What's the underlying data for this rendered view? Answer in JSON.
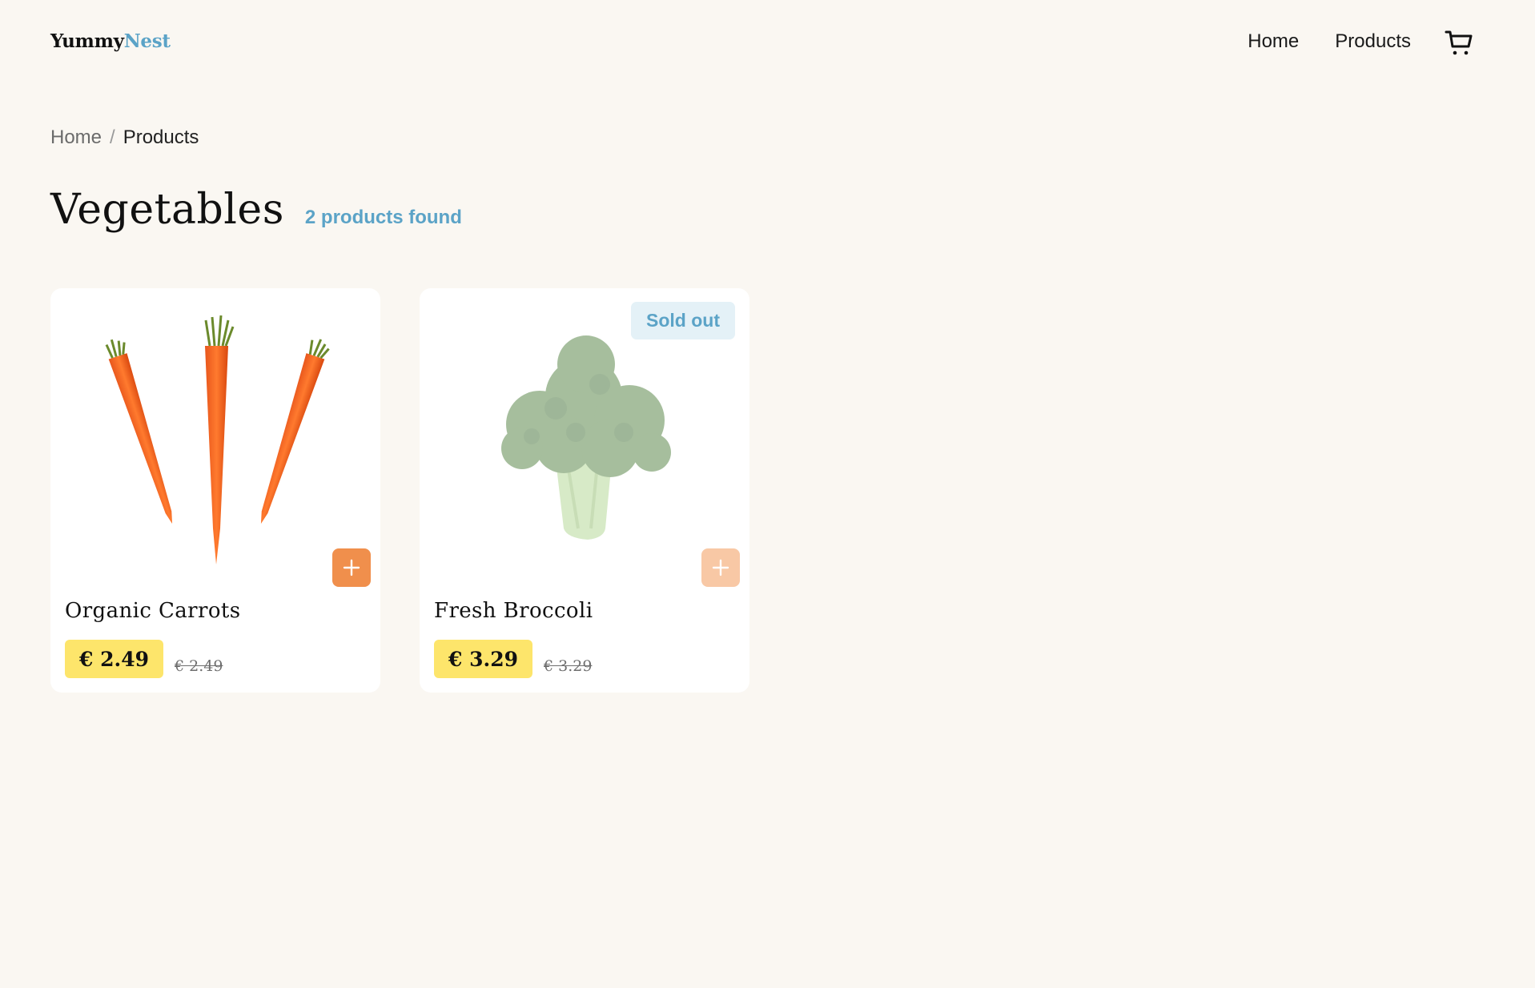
{
  "header": {
    "logo_part1": "Yummy",
    "logo_part2": "Nest",
    "nav": {
      "home": "Home",
      "products": "Products"
    },
    "cart_icon": "shopping-cart-icon"
  },
  "breadcrumb": {
    "home": "Home",
    "separator": "/",
    "current": "Products"
  },
  "page": {
    "title": "Vegetables",
    "count_text": "2 products found"
  },
  "products": [
    {
      "name": "Organic Carrots",
      "price": "€ 2.49",
      "old_price": "€ 2.49",
      "image": "carrots-image",
      "sold_out": false
    },
    {
      "name": "Fresh Broccoli",
      "price": "€ 3.29",
      "old_price": "€ 3.29",
      "image": "broccoli-image",
      "sold_out": true,
      "badge": "Sold out"
    }
  ],
  "colors": {
    "background": "#faf7f2",
    "accent_blue": "#5ba3c7",
    "add_button": "#f08f4c",
    "add_button_disabled": "#f8c8a5",
    "price_badge": "#fde56b",
    "sold_out_badge_bg": "#e4f1f7"
  },
  "icons": {
    "add": "plus-icon",
    "cart": "shopping-cart-icon"
  }
}
